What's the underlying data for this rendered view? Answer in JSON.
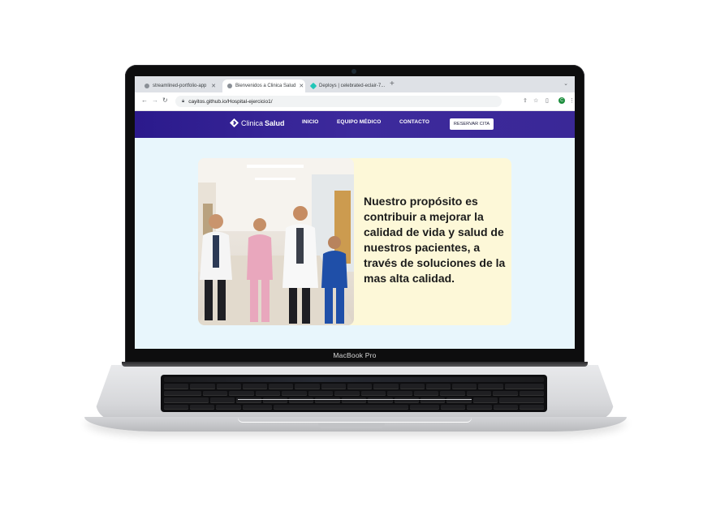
{
  "device": {
    "model_label": "MacBook Pro"
  },
  "browser": {
    "tabs": [
      {
        "title": "streamlined-portfolio-app",
        "active": false,
        "favicon": "globe-icon"
      },
      {
        "title": "Bienvenidos a Clinica Salud",
        "active": true,
        "favicon": "globe-icon"
      },
      {
        "title": "Deploys | celebrated-eclair-7...",
        "active": false,
        "favicon": "netlify-icon"
      }
    ],
    "url": "cayitos.github.io/Hospital-ejercicio1/",
    "profile_initial": "C"
  },
  "site": {
    "brand": {
      "name_regular": "Clinica",
      "name_bold": "Salud"
    },
    "nav": [
      "INICIO",
      "EQUIPO MÉDICO",
      "CONTACTO"
    ],
    "cta_label": "RESERVAR CITA",
    "hero": {
      "text": "Nuestro propósito es contribuir a mejorar la calidad de vida y salud de nuestros pacientes, a través de soluciones de la mas alta calidad."
    }
  },
  "colors": {
    "nav_bg": "#3a2897",
    "page_bg": "#e8f6fc",
    "card_bg": "#fdf8d8"
  }
}
